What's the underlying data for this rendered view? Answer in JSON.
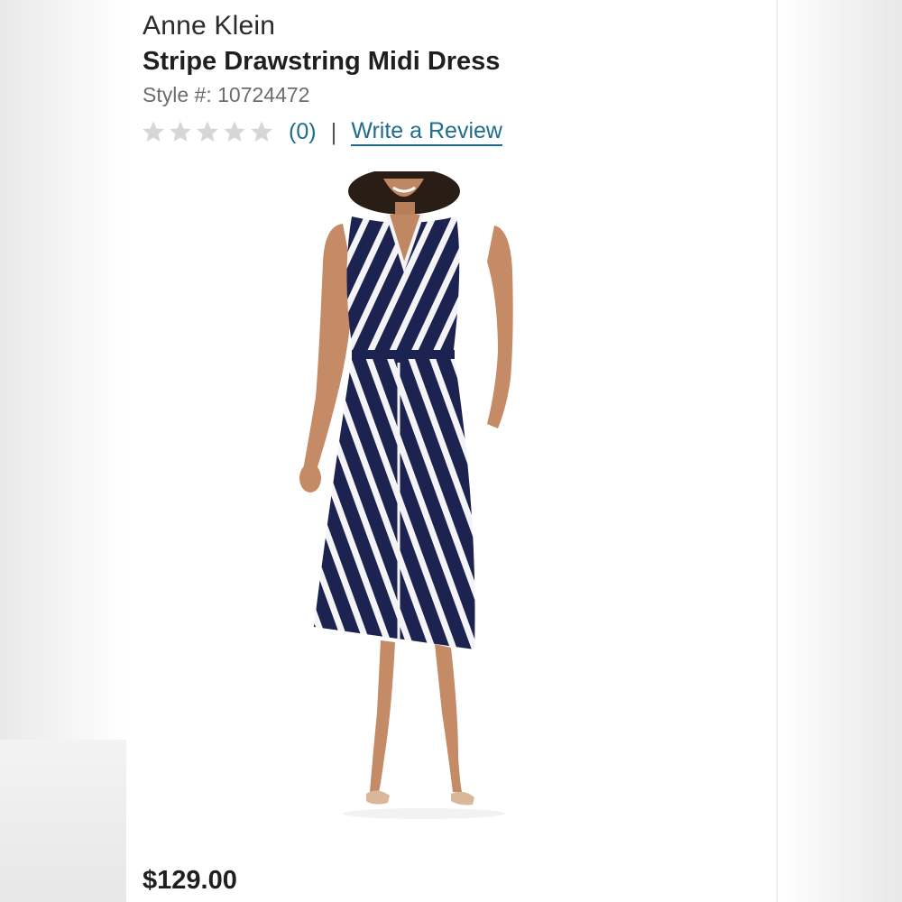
{
  "product": {
    "brand": "Anne Klein",
    "title": "Stripe Drawstring Midi Dress",
    "style_label": "Style #:",
    "style_number": "10724472",
    "rating": {
      "stars_filled": 0,
      "stars_total": 5,
      "count_text": "(0)",
      "separator": "|",
      "write_review_label": "Write a Review"
    },
    "price": "$129.00",
    "image_icon": "product-photo"
  },
  "colors": {
    "link": "#1f6c8f",
    "star_empty": "#d6d6d6",
    "dress_navy": "#1d2350",
    "text_dark": "#1f1f1f"
  }
}
